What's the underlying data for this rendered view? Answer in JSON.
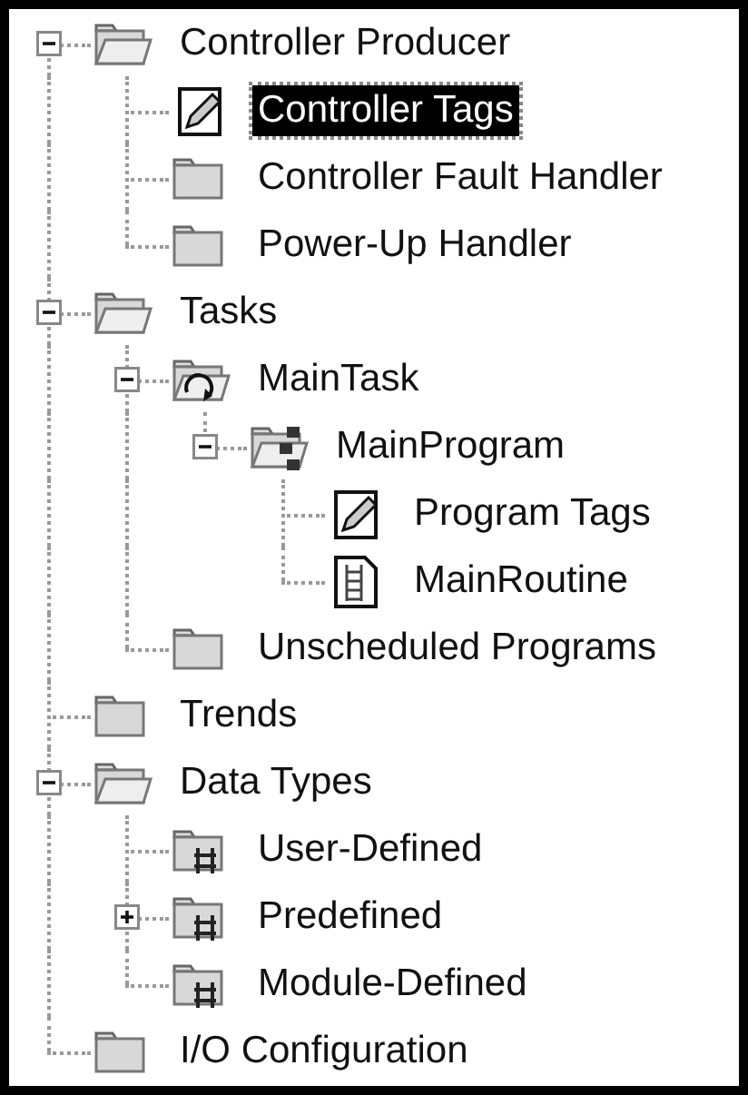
{
  "tree": [
    {
      "label": "Controller Producer",
      "kind": "folder-open",
      "expanded": true,
      "selected": false,
      "children": [
        {
          "label": "Controller Tags",
          "kind": "tags",
          "selected": true
        },
        {
          "label": "Controller Fault Handler",
          "kind": "folder",
          "selected": false
        },
        {
          "label": "Power-Up Handler",
          "kind": "folder",
          "selected": false
        }
      ]
    },
    {
      "label": "Tasks",
      "kind": "folder-open",
      "expanded": true,
      "selected": false,
      "children": [
        {
          "label": "MainTask",
          "kind": "task",
          "expanded": true,
          "selected": false,
          "children": [
            {
              "label": "MainProgram",
              "kind": "program",
              "expanded": true,
              "selected": false,
              "children": [
                {
                  "label": "Program Tags",
                  "kind": "tags",
                  "selected": false
                },
                {
                  "label": "MainRoutine",
                  "kind": "routine",
                  "selected": false
                }
              ]
            }
          ]
        },
        {
          "label": "Unscheduled Programs",
          "kind": "folder",
          "selected": false
        }
      ]
    },
    {
      "label": "Trends",
      "kind": "folder",
      "selected": false
    },
    {
      "label": "Data Types",
      "kind": "folder-open",
      "expanded": true,
      "selected": false,
      "children": [
        {
          "label": "User-Defined",
          "kind": "datatype",
          "selected": false
        },
        {
          "label": "Predefined",
          "kind": "datatype",
          "expanded": false,
          "selected": false
        },
        {
          "label": "Module-Defined",
          "kind": "datatype",
          "selected": false
        }
      ]
    },
    {
      "label": "I/O Configuration",
      "kind": "folder",
      "selected": false
    }
  ]
}
